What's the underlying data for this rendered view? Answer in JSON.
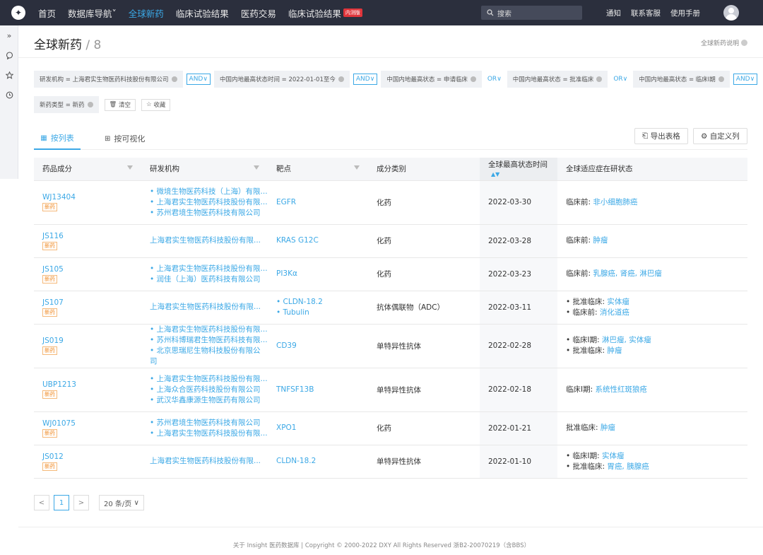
{
  "topbar": {
    "logo": "dxy-logo",
    "nav": [
      {
        "label": "首页"
      },
      {
        "label": "数据库导航"
      },
      {
        "label": "全球新药"
      },
      {
        "label": "临床试验结果"
      },
      {
        "label": "医药交易"
      },
      {
        "label": "临床试验结果"
      }
    ],
    "beta_badge": "内测版",
    "search_placeholder": "搜索",
    "links": [
      "通知",
      "联系客服",
      "使用手册"
    ]
  },
  "sidebar": {
    "icons": [
      "expand-icon",
      "message-icon",
      "star-icon",
      "history-icon"
    ],
    "expand_glyph": "»"
  },
  "page": {
    "title": "全球新药",
    "count": "8",
    "help": "全球新药说明"
  },
  "filters": {
    "row1": [
      {
        "type": "chip",
        "label": "研发机构 = 上海君实生物医药科技股份有限公司"
      },
      {
        "type": "op",
        "label": "AND"
      },
      {
        "type": "chip",
        "label": "中国内地最高状态时间 = 2022-01-01至今"
      },
      {
        "type": "op",
        "label": "AND"
      },
      {
        "type": "chip",
        "label": "中国内地最高状态 = 申请临床"
      },
      {
        "type": "or",
        "label": "OR"
      },
      {
        "type": "chip",
        "label": "中国内地最高状态 = 批准临床"
      },
      {
        "type": "or",
        "label": "OR"
      },
      {
        "type": "chip",
        "label": "中国内地最高状态 = 临床I期"
      },
      {
        "type": "op",
        "label": "AND"
      }
    ],
    "row2_chip": "新药类型 = 新药",
    "clear": "清空",
    "save": "收藏"
  },
  "tabs": [
    {
      "label": "按列表"
    },
    {
      "label": "按可视化"
    }
  ],
  "actions": {
    "export": "导出表格",
    "customize": "自定义列"
  },
  "table": {
    "columns": [
      "药品成分",
      "研发机构",
      "靶点",
      "成分类别",
      "全球最高状态时间",
      "全球适应症在研状态"
    ],
    "tag": "新药",
    "rows": [
      {
        "drug": "WJ13404",
        "orgs": [
          "微境生物医药科技（上海）有限...",
          "上海君实生物医药科技股份有限...",
          "苏州君境生物医药科技有限公司"
        ],
        "targets": [
          "EGFR"
        ],
        "category": "化药",
        "date": "2022-03-30",
        "status": [
          {
            "stage": "临床前",
            "ind": "非小细胞肺癌"
          }
        ]
      },
      {
        "drug": "JS116",
        "orgs": [
          "上海君实生物医药科技股份有限..."
        ],
        "targets": [
          "KRAS G12C"
        ],
        "category": "化药",
        "date": "2022-03-28",
        "status": [
          {
            "stage": "临床前",
            "ind": "肿瘤"
          }
        ]
      },
      {
        "drug": "JS105",
        "orgs": [
          "上海君实生物医药科技股份有限...",
          "润佳（上海）医药科技有限公司"
        ],
        "targets": [
          "PI3Kα"
        ],
        "category": "化药",
        "date": "2022-03-23",
        "status": [
          {
            "stage": "临床前",
            "ind": "乳腺癌, 肾癌, 淋巴瘤"
          }
        ]
      },
      {
        "drug": "JS107",
        "orgs": [
          "上海君实生物医药科技股份有限..."
        ],
        "targets": [
          "CLDN-18.2",
          "Tubulin"
        ],
        "category": "抗体偶联物（ADC）",
        "date": "2022-03-11",
        "status": [
          {
            "stage": "批准临床",
            "ind": "实体瘤"
          },
          {
            "stage": "临床前",
            "ind": "消化道癌"
          }
        ]
      },
      {
        "drug": "JS019",
        "orgs": [
          "上海君实生物医药科技股份有限...",
          "苏州科博瑞君生物医药科技有限...",
          "北京思瑞尼生物科技股份有限公司"
        ],
        "targets": [
          "CD39"
        ],
        "category": "单特异性抗体",
        "date": "2022-02-28",
        "status": [
          {
            "stage": "临床I期",
            "ind": "淋巴瘤, 实体瘤"
          },
          {
            "stage": "批准临床",
            "ind": "肿瘤"
          }
        ]
      },
      {
        "drug": "UBP1213",
        "orgs": [
          "上海君实生物医药科技股份有限...",
          "上海众合医药科技股份有限公司",
          "武汉华鑫康源生物医药有限公司"
        ],
        "targets": [
          "TNFSF13B"
        ],
        "category": "单特异性抗体",
        "date": "2022-02-18",
        "status": [
          {
            "stage": "临床I期",
            "ind": "系统性红斑狼疮"
          }
        ]
      },
      {
        "drug": "WJ01075",
        "orgs": [
          "苏州君境生物医药科技有限公司",
          "上海君实生物医药科技股份有限..."
        ],
        "targets": [
          "XPO1"
        ],
        "category": "化药",
        "date": "2022-01-21",
        "status": [
          {
            "stage": "批准临床",
            "ind": "肿瘤"
          }
        ]
      },
      {
        "drug": "JS012",
        "orgs": [
          "上海君实生物医药科技股份有限..."
        ],
        "targets": [
          "CLDN-18.2"
        ],
        "category": "单特异性抗体",
        "date": "2022-01-10",
        "status": [
          {
            "stage": "临床I期",
            "ind": "实体瘤"
          },
          {
            "stage": "批准临床",
            "ind": "胃癌, 胰腺癌"
          }
        ]
      }
    ]
  },
  "pagination": {
    "prev": "<",
    "current": "1",
    "next": ">",
    "page_size": "20 条/页"
  },
  "footer": "关于 Insight 医药数据库 | Copyright © 2000-2022 DXY All Rights Reserved 浙B2-20070219（含BBS）",
  "colors": {
    "accent": "#3ba8e6",
    "topbar": "#2b2f3d",
    "tag": "#f08a24"
  }
}
